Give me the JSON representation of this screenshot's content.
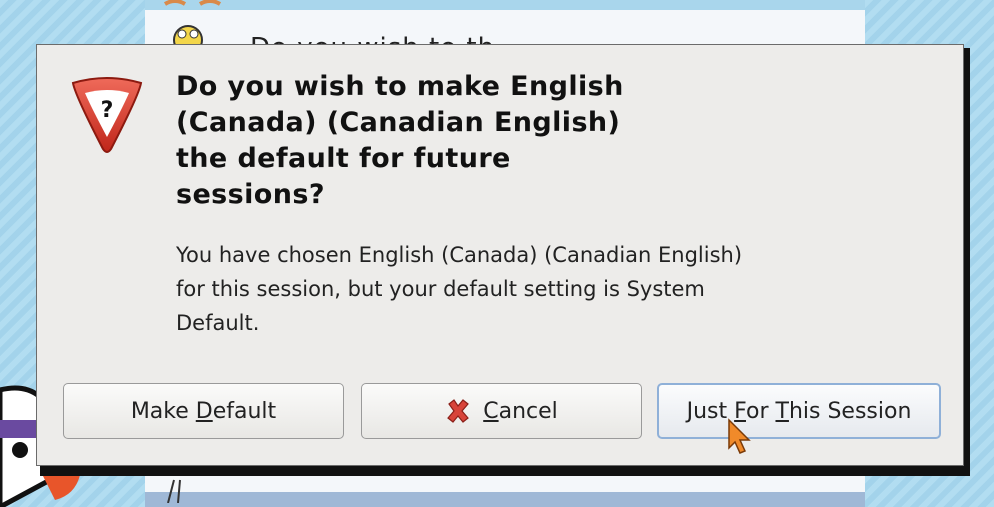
{
  "dialog": {
    "title": "Do you wish to make English (Canada) (Canadian English) the default for future sessions?",
    "title_lines": [
      "Do you wish to make English",
      "(Canada) (Canadian English)",
      "the default for future",
      "sessions?"
    ],
    "message_lines": [
      "You have chosen English (Canada) (Canadian English)",
      "for this session, but your default setting is System",
      "Default."
    ],
    "icon": "warning-question-icon"
  },
  "buttons": {
    "make_default": {
      "pre": "Make ",
      "mnemonic": "D",
      "post": "efault"
    },
    "cancel": {
      "pre": "",
      "mnemonic": "C",
      "post": "ancel",
      "icon": "cancel-x-icon"
    },
    "just_session": {
      "pre": "Just ",
      "mnemonic1": "F",
      "mid": "or ",
      "mnemonic2": "T",
      "post": "his Session"
    }
  },
  "background": {
    "partial_text": "Do you wish to th"
  },
  "colors": {
    "dialog_bg": "#edecea",
    "accent_focus": "#8fb0d8",
    "warning_red": "#d23a2a"
  }
}
